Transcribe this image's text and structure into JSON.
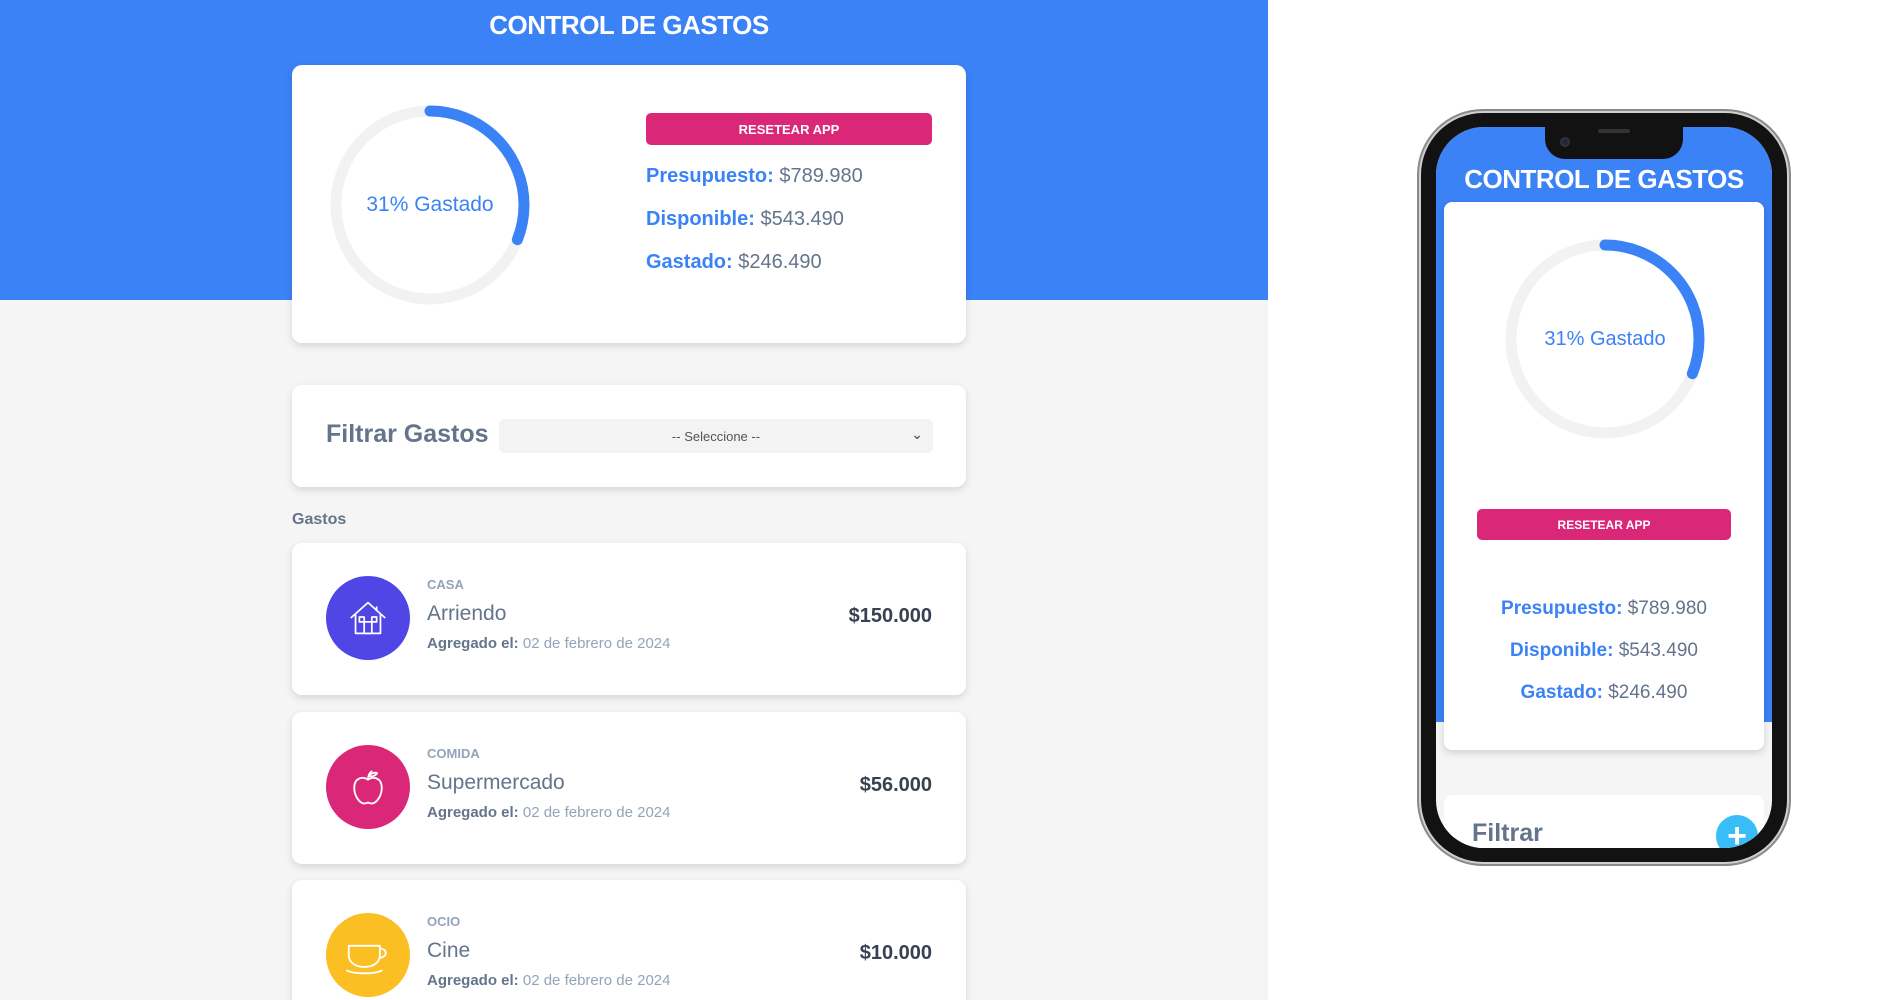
{
  "app": {
    "title": "CONTROL DE GASTOS"
  },
  "budget": {
    "percent_label": "31% Gastado",
    "percent_spent": 31,
    "reset_label": "RESETEAR APP",
    "presupuesto": {
      "label": "Presupuesto:",
      "value": "$789.980"
    },
    "disponible": {
      "label": "Disponible:",
      "value": "$543.490"
    },
    "gastado": {
      "label": "Gastado:",
      "value": "$246.490"
    }
  },
  "filter": {
    "label": "Filtrar Gastos",
    "selected": "-- Seleccione --"
  },
  "gastos": {
    "section_label": "Gastos",
    "date_label": "Agregado el:",
    "items": [
      {
        "category": "CASA",
        "name": "Arriendo",
        "date": "02 de febrero de 2024",
        "amount": "$150.000",
        "icon": "house-icon",
        "color": "#4f46e5"
      },
      {
        "category": "COMIDA",
        "name": "Supermercado",
        "date": "02 de febrero de 2024",
        "amount": "$56.000",
        "icon": "apple-icon",
        "color": "#db2777"
      },
      {
        "category": "OCIO",
        "name": "Cine",
        "date": "02 de febrero de 2024",
        "amount": "$10.000",
        "icon": "cup-icon",
        "color": "#fbbf24"
      }
    ]
  },
  "mobile": {
    "filter_label_partial": "Filtrar",
    "add_label": "+"
  },
  "colors": {
    "primary": "#3b82f6",
    "reset": "#db2777",
    "background": "#f5f5f5",
    "fab": "#38bdf8"
  }
}
